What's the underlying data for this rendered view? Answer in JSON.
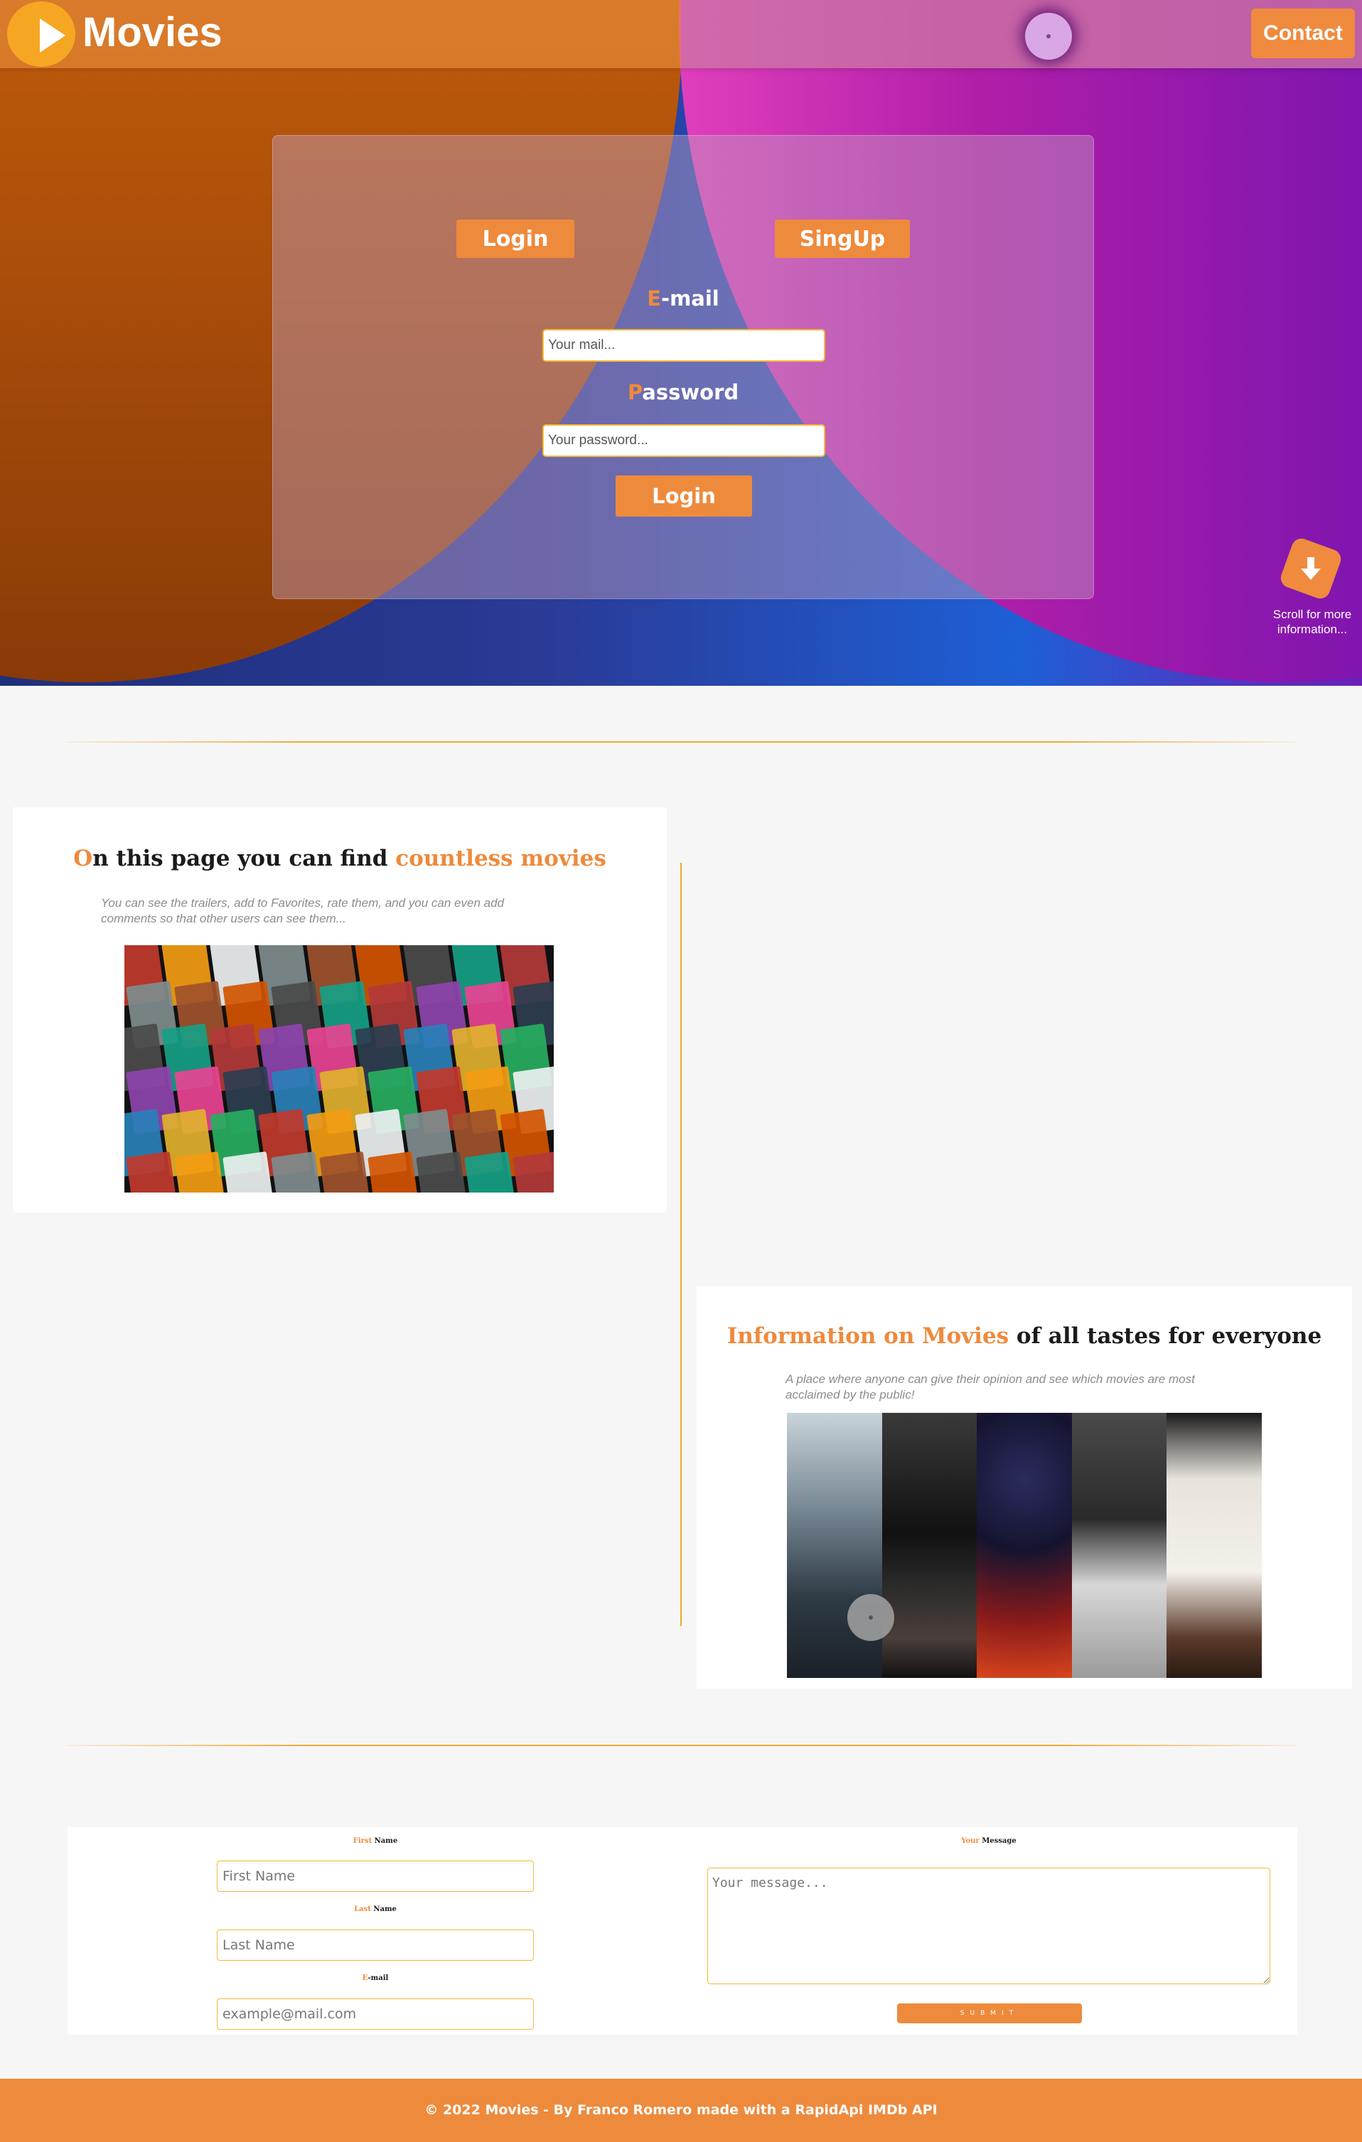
{
  "nav": {
    "brand": "Movies",
    "contact_label": "Contact"
  },
  "login": {
    "tab_login": "Login",
    "tab_signup": "SingUp",
    "email_label_first": "E",
    "email_label_rest": "-mail",
    "email_placeholder": "Your mail...",
    "password_label_first": "P",
    "password_label_rest": "assword",
    "password_placeholder": "Your password...",
    "submit_label": "Login"
  },
  "scroll_hint": {
    "text": "Scroll for more information..."
  },
  "section1": {
    "title_first": "O",
    "title_mid": "n this page you can find ",
    "title_highlight": "countless movies",
    "description": "You can see the trailers, add to Favorites, rate them, and you can even add comments so that other users can see them..."
  },
  "section2": {
    "title_highlight": "Information on Movies",
    "title_rest": " of all tastes for everyone",
    "description": "A place where anyone can give their opinion and see which movies are most acclaimed by the public!"
  },
  "contact_form": {
    "first_name_label_first": "First",
    "first_name_label_rest": " Name",
    "first_name_placeholder": "First Name",
    "last_name_label_first": "Last",
    "last_name_label_rest": " Name",
    "last_name_placeholder": "Last Name",
    "email_label_first": "E",
    "email_label_rest": "-mail",
    "email_placeholder": "example@mail.com",
    "message_label_first": "Your",
    "message_label_rest": " Message",
    "message_placeholder": "Your message...",
    "submit_label": "SUBMIT"
  },
  "footer": {
    "text": "© 2022 Movies - By Franco Romero made with a RapidApi IMDb API"
  },
  "icons": {
    "logo": "play-icon",
    "theme_toggle": "theme-toggle-icon",
    "scroll": "arrow-down-icon"
  },
  "colors": {
    "accent": "#ee8a3c",
    "input_border": "#f5b83a",
    "footer": "#ee8a3c"
  }
}
